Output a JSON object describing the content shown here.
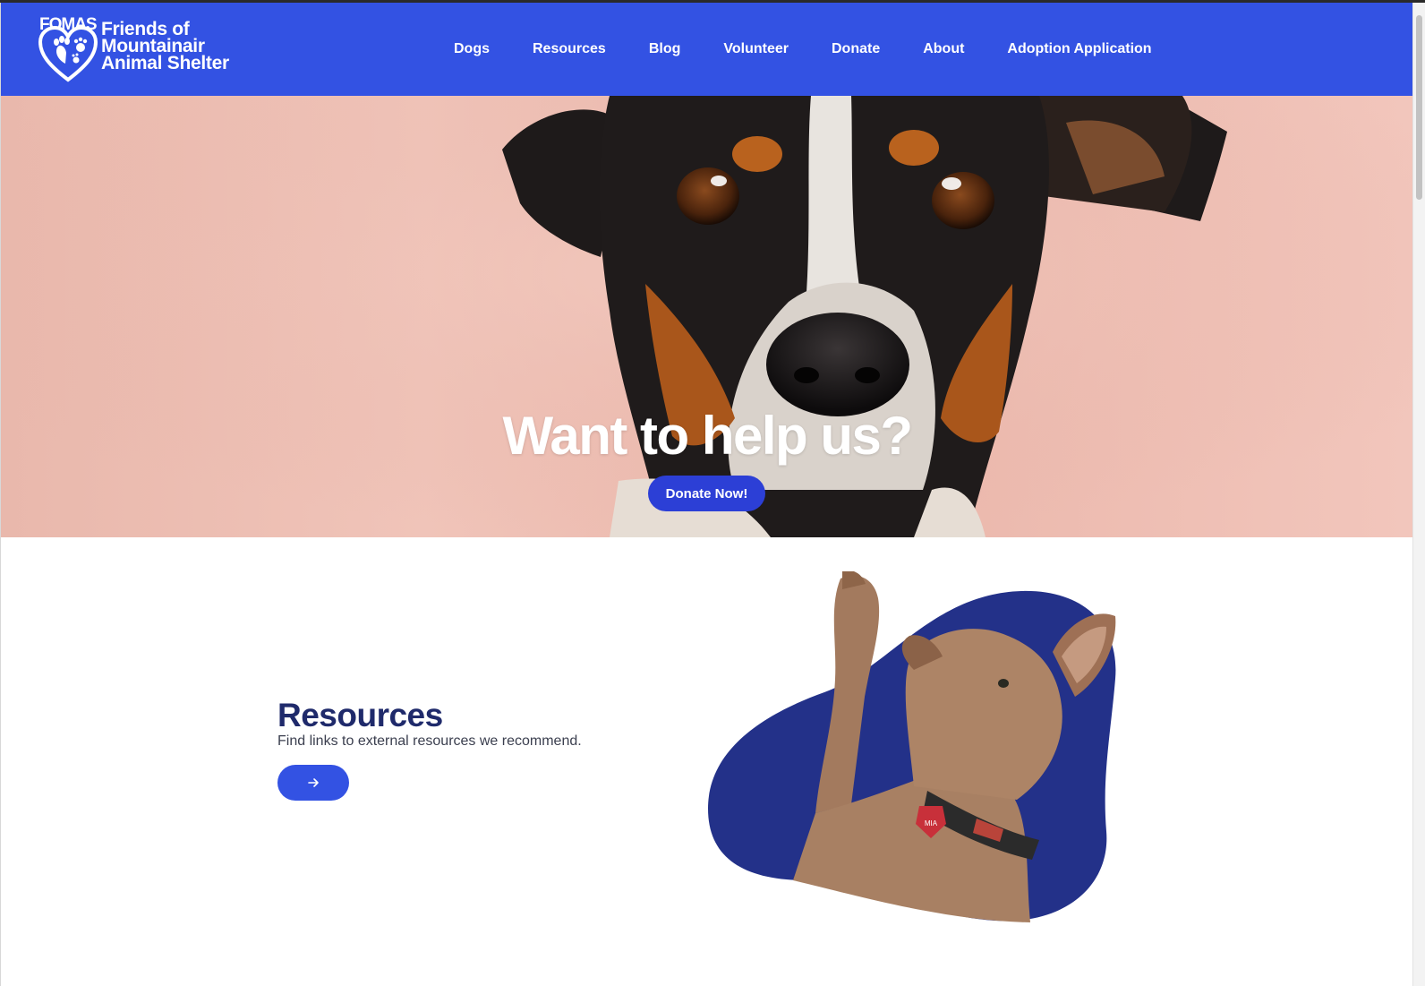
{
  "brand": {
    "logo_abbrev": "FOMAS",
    "name_line1": "Friends of",
    "name_line2": "Mountainair",
    "name_line3": "Animal Shelter"
  },
  "nav": {
    "items": [
      "Dogs",
      "Resources",
      "Blog",
      "Volunteer",
      "Donate",
      "About",
      "Adoption Application"
    ]
  },
  "hero": {
    "title": "Want to help us?",
    "button_label": "Donate Now!",
    "image": "dog-portrait-photo"
  },
  "resources": {
    "title": "Resources",
    "description": "Find links to external resources we recommend.",
    "button_icon": "arrow-right-icon",
    "image": "dog-raising-paw-photo",
    "collar_tag": "MIA"
  },
  "colors": {
    "header_bg": "#3352e3",
    "button_bg": "#2c3fd6",
    "blob": "#233189",
    "heading": "#1f2a6b",
    "hero_bg": "#efc0b5"
  }
}
